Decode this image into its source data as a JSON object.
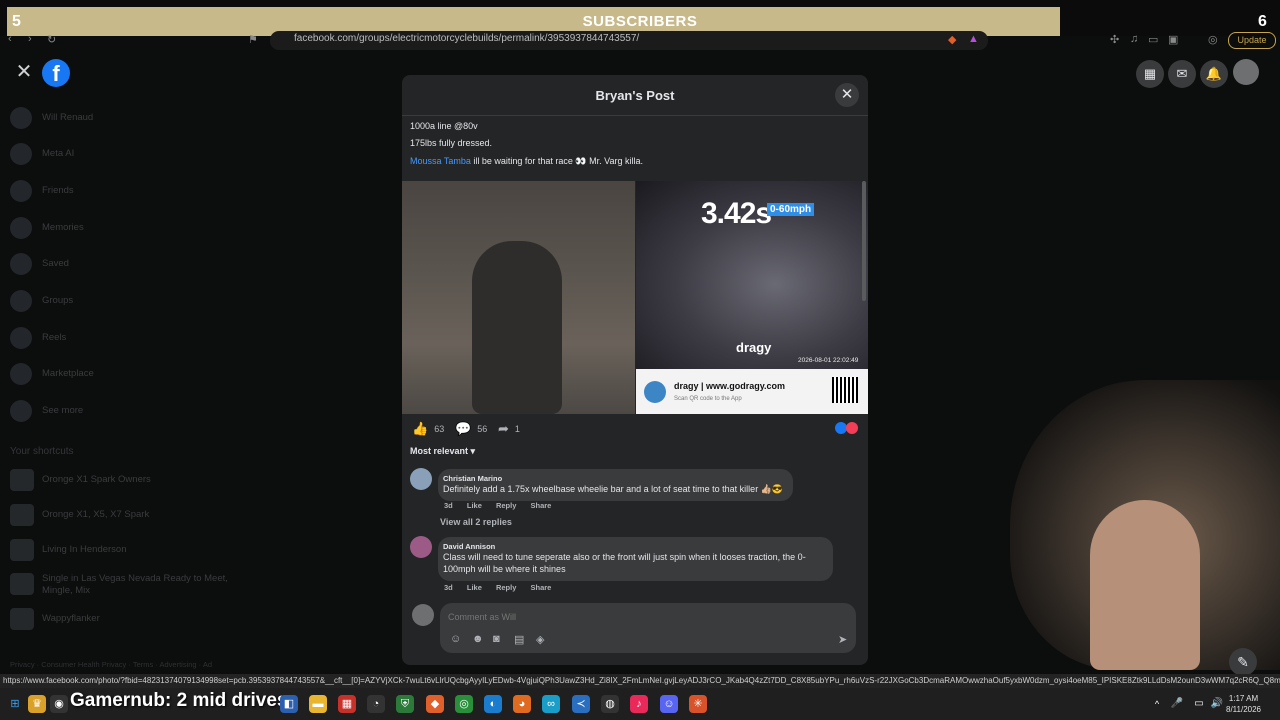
{
  "subscriber_bar": {
    "title": "SUBSCRIBERS",
    "left_count": "5",
    "right_count": "6"
  },
  "browser": {
    "url": "facebook.com/groups/electricmotorcyclebuilds/permalink/3953937844743557/",
    "update_label": "Update"
  },
  "sidebar": {
    "items": [
      {
        "label": "Will Renaud"
      },
      {
        "label": "Meta AI"
      },
      {
        "label": "Friends"
      },
      {
        "label": "Memories"
      },
      {
        "label": "Saved"
      },
      {
        "label": "Groups"
      },
      {
        "label": "Reels"
      },
      {
        "label": "Marketplace"
      },
      {
        "label": "See more"
      }
    ],
    "shortcuts_title": "Your shortcuts",
    "shortcuts": [
      {
        "label": "Oronge X1 Spark Owners"
      },
      {
        "label": "Oronge X1, X5, X7 Spark"
      },
      {
        "label": "Living In Henderson"
      },
      {
        "label": "Single in Las Vegas Nevada Ready to Meet, Mingle, Mix"
      },
      {
        "label": "Wappyflanker"
      }
    ],
    "footer": "Privacy · Consumer Health Privacy · Terms · Advertising · Ad"
  },
  "modal": {
    "title": "Bryan's Post",
    "post_lines": [
      "1000a line @80v",
      "175lbs fully dressed."
    ],
    "mention_name": "Moussa Tamba",
    "mention_text": " ill be waiting for that race 👀 Mr. Varg killa.",
    "image_right": {
      "time": "3.42s",
      "badge": "0-60mph",
      "logo": "dragy",
      "date": "2026-08-01 22:02:49",
      "ad_line": "dragy  |  www.godragy.com",
      "ad_sub": "Scan QR code to the App"
    },
    "stats": {
      "likes": "63",
      "comments": "56",
      "shares": "1"
    },
    "sort_label": "Most relevant",
    "comments": [
      {
        "name": "Christian Marino",
        "text": "Definitely add a 1.75x wheelbase wheelie bar and a lot of seat time to that killer 👍🏼😎",
        "time": "3d",
        "like": "Like",
        "reply": "Reply",
        "share": "Share"
      },
      {
        "name": "David Annison",
        "text": "Class will need to tune seperate also or the front will just spin when it looses traction, the 0-100mph will be where it shines",
        "time": "3d",
        "like": "Like",
        "reply": "Reply",
        "share": "Share"
      }
    ],
    "view_replies": "View all 2 replies",
    "composer_placeholder": "Comment as Will"
  },
  "status_url": "https://www.facebook.com/photo/?fbid=48231374079134998set=pcb.3953937844743557&__cft__[0]=AZYVjXCk-7wuLt6vLlrUQcbgAyyILyEDwb-4VgjuiQPh3UawZ3Hd_Zi8IX_2FmLmNeI.gvjLeyADJ3rCO_JKab4Q4zZt7DD_C8X85ubYPu_rh6uVzS-r22JXGoCb3DcmaRAMOwwzhaOuf5yxbW0dzm_oysi4oeM85_IPISKE8Ztk9LLdDsM2ounD3wWM7q2cR6Q_Q8mG...",
  "taskbar": {
    "overlay_text": "Gamernub: 2 mid drives",
    "time": "1:17 AM",
    "date": "8/11/2026"
  }
}
